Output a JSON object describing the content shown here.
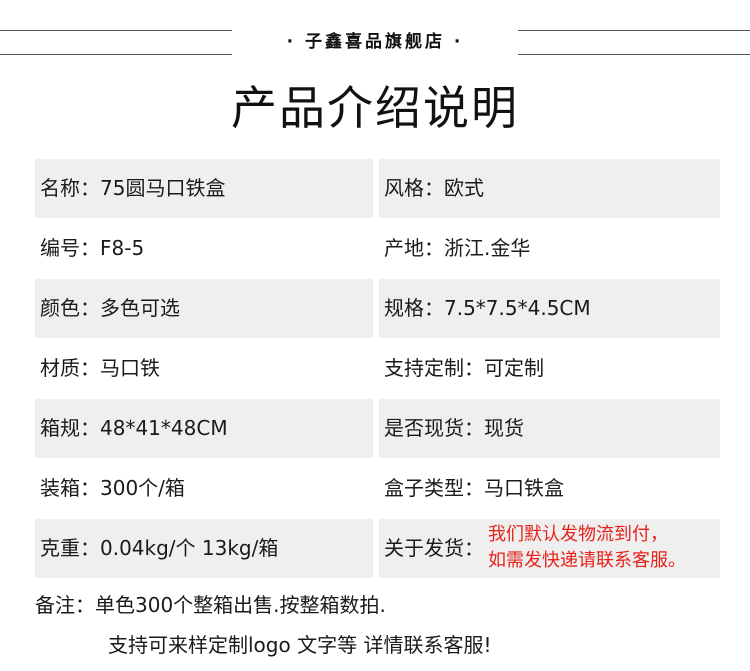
{
  "header": {
    "shop_name": "· 子鑫喜品旗舰店 ·"
  },
  "title": "产品介绍说明",
  "separator": "：",
  "specs": {
    "name": {
      "label": "名称",
      "value": "75圆马口铁盒"
    },
    "style": {
      "label": "风格",
      "value": "欧式"
    },
    "code": {
      "label": "编号",
      "value": "F8-5"
    },
    "origin": {
      "label": "产地",
      "value": "浙江.金华"
    },
    "color": {
      "label": "颜色",
      "value": "多色可选"
    },
    "size": {
      "label": "规格",
      "value": "7.5*7.5*4.5CM"
    },
    "material": {
      "label": "材质",
      "value": "马口铁"
    },
    "custom": {
      "label": "支持定制",
      "value": "可定制"
    },
    "carton_size": {
      "label": "箱规",
      "value": "48*41*48CM"
    },
    "in_stock": {
      "label": "是否现货",
      "value": "现货"
    },
    "packing": {
      "label": "装箱",
      "value": "300个/箱"
    },
    "box_type": {
      "label": "盒子类型",
      "value": "马口铁盒"
    },
    "weight": {
      "label": "克重",
      "value": "0.04kg/个 13kg/箱"
    },
    "shipping": {
      "label": "关于发货",
      "note_line1": "我们默认发物流到付，",
      "note_line2": "如需发快递请联系客服。"
    }
  },
  "remarks": {
    "label": "备注",
    "line1": "单色300个整箱出售.按整箱数拍.",
    "line2": "支持可来样定制logo 文字等 详情联系客服!"
  },
  "colors": {
    "cell_background": "#efefef",
    "note_red": "#e8221b",
    "text": "#1a1a1a"
  }
}
